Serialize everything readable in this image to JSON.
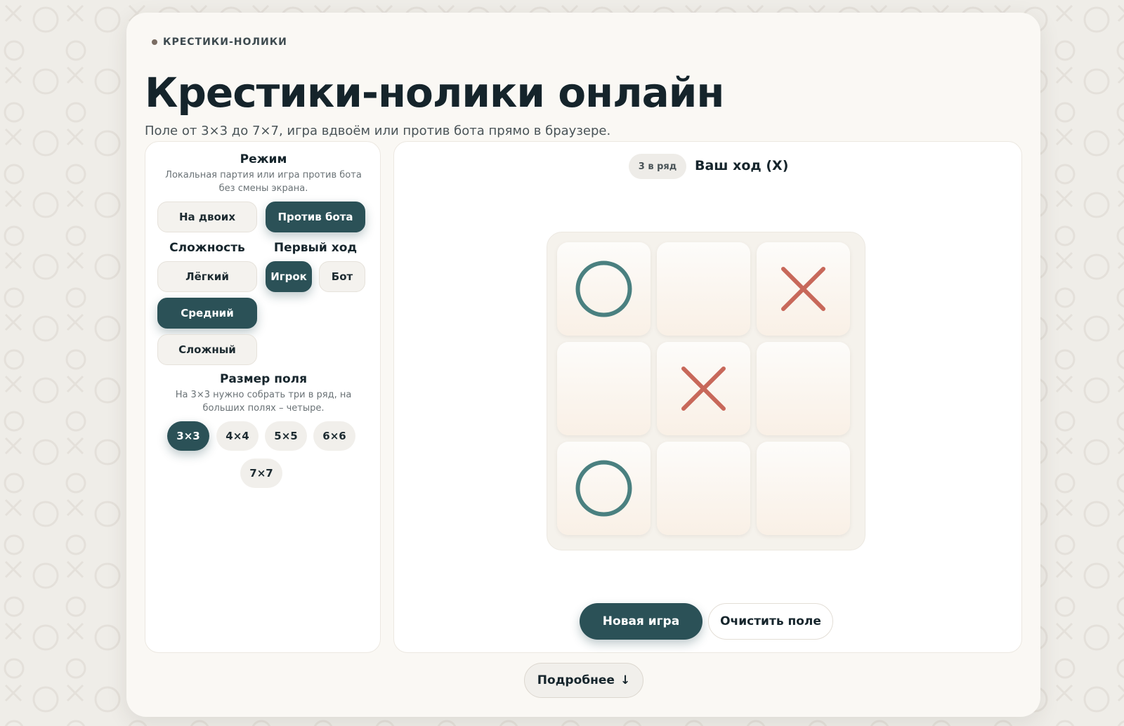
{
  "header": {
    "eyebrow": "КРЕСТИКИ-НОЛИКИ",
    "title": "Крестики-нолики онлайн",
    "subtitle": "Поле от 3×3 до 7×7, игра вдвоём или против бота прямо в браузере."
  },
  "settings": {
    "mode": {
      "title": "Режим",
      "description": "Локальная партия или игра против бота без смены экрана.",
      "options": [
        "На двоих",
        "Против бота"
      ],
      "selected": "Против бота"
    },
    "difficulty": {
      "title": "Сложность",
      "options": [
        "Лёгкий",
        "Средний",
        "Сложный"
      ],
      "selected": "Средний"
    },
    "first_move": {
      "title": "Первый ход",
      "options": [
        "Игрок",
        "Бот"
      ],
      "selected": "Игрок"
    },
    "board_size": {
      "title": "Размер поля",
      "description": "На 3×3 нужно собрать три в ряд, на больших полях – четыре.",
      "options": [
        "3×3",
        "4×4",
        "5×5",
        "6×6",
        "7×7"
      ],
      "selected": "3×3"
    }
  },
  "game": {
    "win_badge": "3 в ряд",
    "status": "Ваш ход (X)",
    "board": [
      [
        "O",
        "",
        "X"
      ],
      [
        "",
        "X",
        ""
      ],
      [
        "O",
        "",
        ""
      ]
    ],
    "colors": {
      "x": "#c8685a",
      "o": "#4a8080"
    }
  },
  "actions": {
    "new_game": "Новая игра",
    "clear_board": "Очистить поле",
    "more": "Подробнее",
    "more_icon": "↓"
  }
}
